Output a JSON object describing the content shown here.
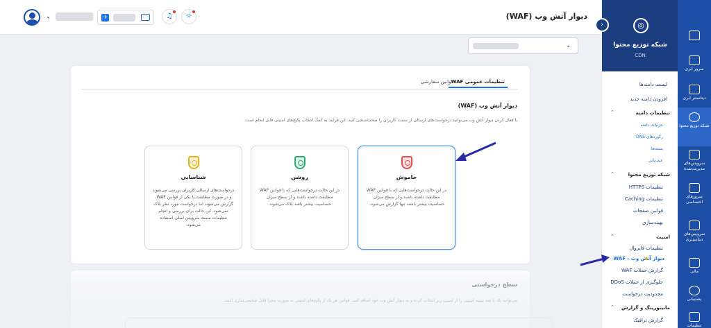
{
  "header": {
    "title": "دیوار آتش وب (WAF)"
  },
  "selector": {
    "value": ""
  },
  "sidebar": {
    "product_title": "شبکه توزیع محتوا",
    "product_sub": "CDN",
    "items": [
      {
        "label": "لیست دامنه‌ها",
        "kind": "item"
      },
      {
        "label": "افزودن دامنه جدید",
        "kind": "item"
      },
      {
        "label": "تنظیمات دامنه",
        "kind": "sec"
      },
      {
        "label": "جزئیات دامنه",
        "kind": "sub"
      },
      {
        "label": "رکوردهای DNS",
        "kind": "sub"
      },
      {
        "label": "بسته‌ها",
        "kind": "sub"
      },
      {
        "label": "عیب‌یابی",
        "kind": "sub"
      },
      {
        "label": "شبکه توزیع محتوا",
        "kind": "sec"
      },
      {
        "label": "تنظیمات HTTPS",
        "kind": "item"
      },
      {
        "label": "تنظیمات Caching",
        "kind": "item"
      },
      {
        "label": "قوانین صفحات",
        "kind": "item"
      },
      {
        "label": "بهینه‌سازی",
        "kind": "item"
      },
      {
        "label": "امنیت",
        "kind": "sec"
      },
      {
        "label": "تنظیمات فایروال",
        "kind": "item"
      },
      {
        "label": "دیوار آتش وب - WAF",
        "kind": "active"
      },
      {
        "label": "گزارش حملات WAF",
        "kind": "item"
      },
      {
        "label": "جلوگیری از حملات DDoS",
        "kind": "item"
      },
      {
        "label": "محدودیت درخواست",
        "kind": "item"
      },
      {
        "label": "مانیتورینگ و گزارش",
        "kind": "sec"
      },
      {
        "label": "گزارش ترافیک",
        "kind": "item"
      }
    ]
  },
  "rail": {
    "items": [
      {
        "label": ""
      },
      {
        "label": "سرور ابری"
      },
      {
        "label": "دیتاسنتر ابری"
      },
      {
        "label": "شبکه توزیع محتوا"
      },
      {
        "label": "سرویس‌های مدیریت‌شده"
      },
      {
        "label": "سرورهای اختصاصی"
      },
      {
        "label": "سرویس‌های دیتاسنتری"
      },
      {
        "label": "مالی"
      },
      {
        "label": "پشتیبانی"
      },
      {
        "label": "تنظیمات"
      }
    ]
  },
  "main": {
    "tabs": [
      "تنظیمات عمومی WAF",
      "قوانین سفارشی"
    ],
    "section_title": "دیوار آتش وب (WAF)",
    "section_desc": "با فعال کردن دیوار آتش وب می‌توانید درخواست‌های ارسالی از سمت کاربران را صحت‌سنجی کنید. این فرایند به کمک انتخاب پکیج‌های امنیتی قابل انجام است.",
    "options": [
      {
        "name": "خاموش",
        "desc": "در این حالت درخواست‌هایی که با قوانین WAF مطابقت داشته باشند و از سطح میزان حساسیت بیشتر باشند تنها گزارش می‌شوند.",
        "color": "#e05252",
        "selected": true
      },
      {
        "name": "روشن",
        "desc": "در این حالت درخواست‌هایی که با قوانین WAF مطابقت داشته باشند و از سطح میزان حساسیت بیشتر باشد بلاک می‌شوند.",
        "color": "#2eaa72",
        "selected": false
      },
      {
        "name": "شناسایی",
        "desc": "درخواست‌های ارسالی کاربران بررسی می‌شوند و در صورت مطابقت با یکی از قوانین WAF، گزارش می‌شوند اما درخواست مورد نظر بلاک نمی‌شود. این حالت برای بررسی و انجام تنظیمات سمت سرویس اصلی استفاده می‌شود.",
        "color": "#e8b21e",
        "selected": false
      }
    ]
  },
  "request_level": {
    "title": "سطح درخواستی",
    "desc": "می‌توانید یک یا چند بسته امنیتی را از لیست زیر انتخاب کرده و به دیوار آتش وب خود اضافه کنید. قوانین هر یک از پکیج‌های امنیتی به صورت مجزا قابل شخصی‌سازی است."
  }
}
